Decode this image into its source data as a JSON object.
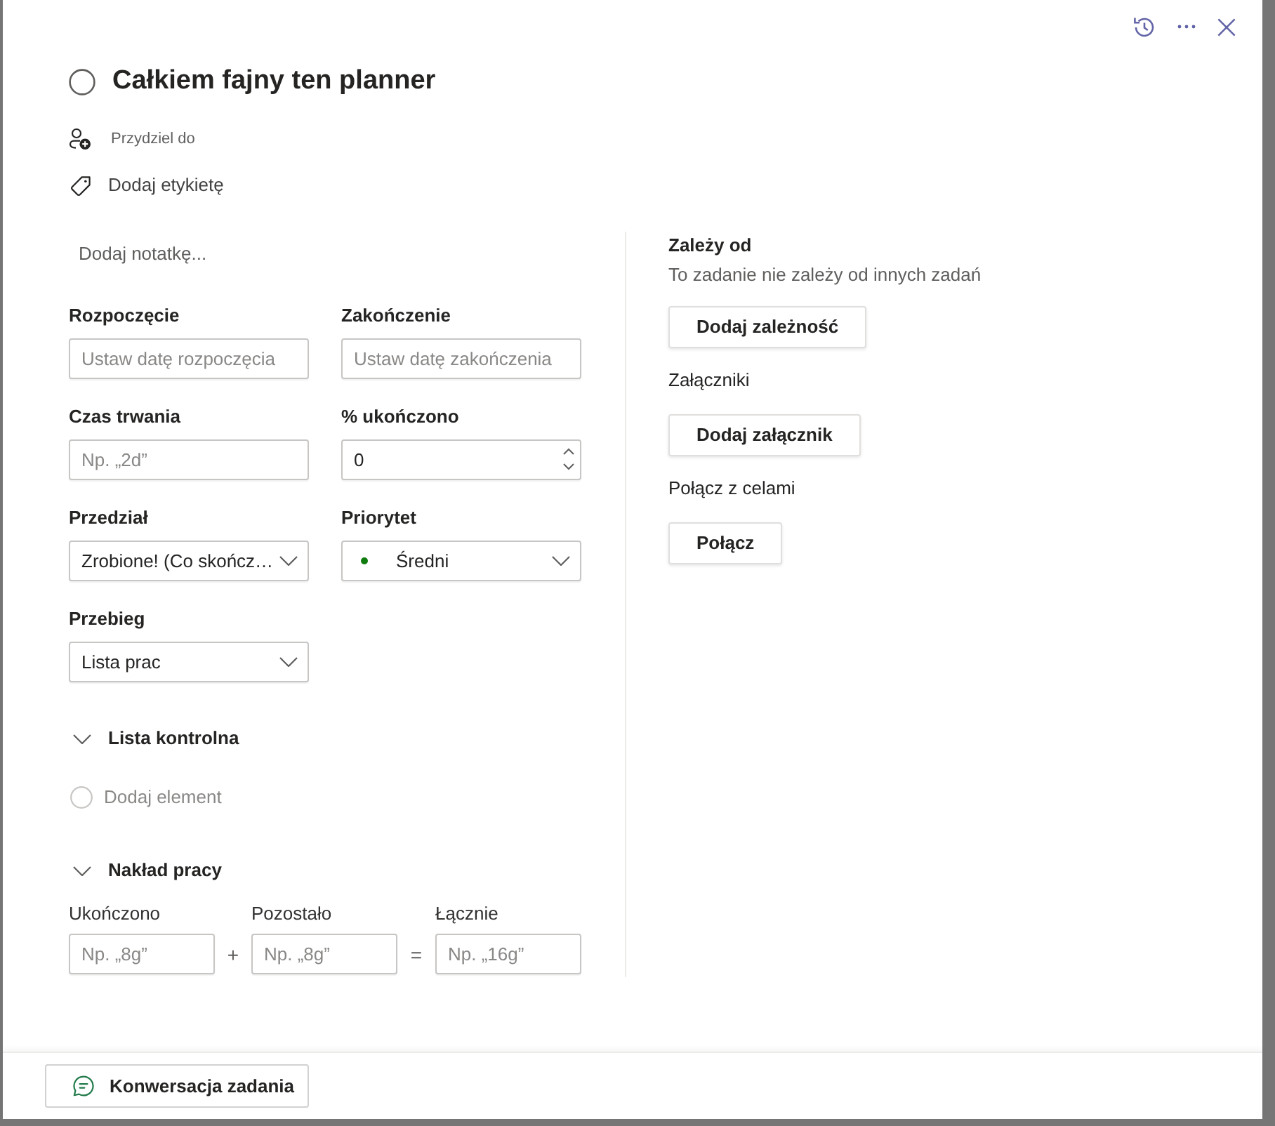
{
  "task": {
    "title": "Całkiem fajny ten planner",
    "completed": false
  },
  "assign": {
    "label": "Przydziel do"
  },
  "tag": {
    "label": "Dodaj etykietę"
  },
  "notes": {
    "placeholder": "Dodaj notatkę..."
  },
  "fields": [
    {
      "label": "Rozpoczęcie",
      "kind": "text",
      "placeholder": "Ustaw datę rozpoczęcia"
    },
    {
      "label": "Zakończenie",
      "kind": "text",
      "placeholder": "Ustaw datę zakończenia"
    },
    {
      "label": "Czas trwania",
      "kind": "text",
      "placeholder": "Np. „2d”"
    },
    {
      "label": "% ukończono",
      "kind": "number",
      "value": "0"
    },
    {
      "label": "Przedział",
      "kind": "dropdown",
      "value": "Zrobione! (Co skończ…"
    },
    {
      "label": "Priorytet",
      "kind": "dropdown",
      "value": "Średni",
      "color": "#107c10"
    },
    {
      "label": "Przebieg",
      "kind": "dropdown",
      "value": "Lista prac"
    }
  ],
  "checklist": {
    "title": "Lista kontrolna",
    "expanded": true,
    "placeholder": "Dodaj element"
  },
  "effort": {
    "title": "Nakład pracy",
    "expanded": true,
    "columns": [
      {
        "label": "Ukończono",
        "placeholder": "Np. „8g”"
      },
      {
        "label": "Pozostało",
        "placeholder": "Np. „8g”"
      },
      {
        "label": "Łącznie",
        "placeholder": "Np. „16g”"
      }
    ],
    "operators": [
      "+",
      "="
    ]
  },
  "sections": [
    {
      "title": "Zależy od",
      "title_bold": true,
      "description": "To zadanie nie zależy od innych zadań",
      "button": "Dodaj zależność"
    },
    {
      "title": "Załączniki",
      "title_bold": false,
      "button": "Dodaj załącznik"
    },
    {
      "title": "Połącz z celami",
      "title_bold": false,
      "button": "Połącz"
    }
  ],
  "footer": {
    "button": "Konwersacja zadania"
  }
}
